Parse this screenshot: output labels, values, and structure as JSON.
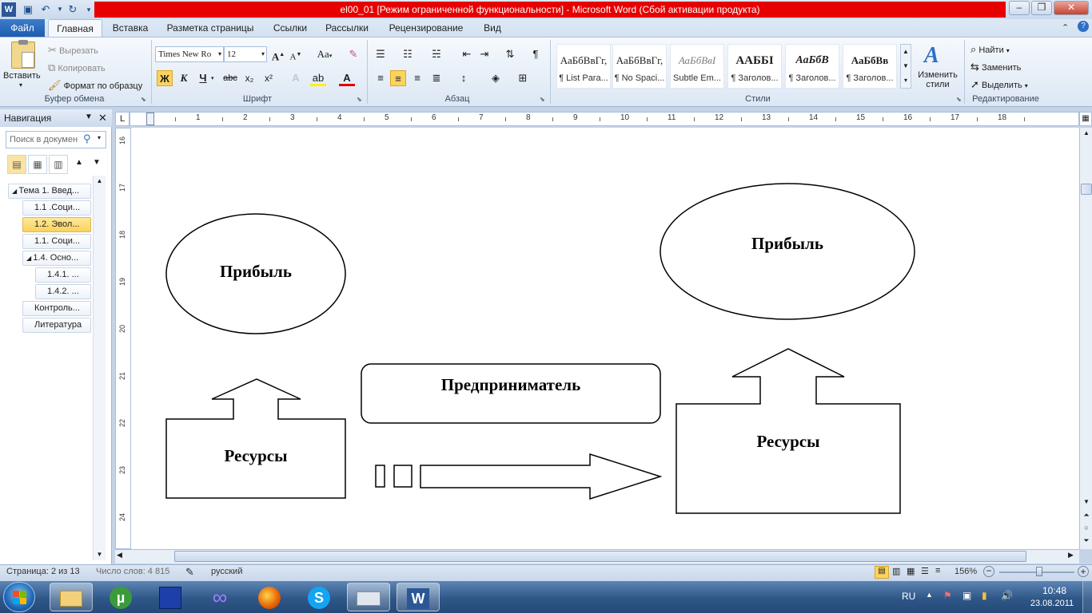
{
  "window": {
    "title": "el00_01 [Режим ограниченной функциональности]  -  Microsoft Word (Сбой активации продукта)",
    "controls": [
      "–",
      "❐",
      "✕"
    ]
  },
  "quick_access": {
    "icons": [
      "word-icon",
      "save-icon",
      "undo-icon",
      "redo-icon",
      "customize-icon"
    ]
  },
  "tabs": {
    "file": "Файл",
    "items": [
      "Главная",
      "Вставка",
      "Разметка страницы",
      "Ссылки",
      "Рассылки",
      "Рецензирование",
      "Вид"
    ],
    "active": "Главная"
  },
  "clipboard": {
    "paste": "Вставить",
    "cut": "Вырезать",
    "copy": "Копировать",
    "format_painter": "Формат по образцу",
    "label": "Буфер обмена"
  },
  "font": {
    "name": "Times New Ro",
    "size": "12",
    "label": "Шрифт",
    "bold": "Ж",
    "italic": "К",
    "underline": "Ч",
    "strike": "abc",
    "sub": "x₂",
    "sup": "x²",
    "grow": "A",
    "shrink": "A",
    "case": "Aa"
  },
  "paragraph": {
    "label": "Абзац"
  },
  "styles": {
    "label": "Стили",
    "items": [
      {
        "sample": "АаБбВвГг,",
        "name": "¶ List Para..."
      },
      {
        "sample": "АаБбВвГг,",
        "name": "¶ No Spaci..."
      },
      {
        "sample": "АаБбВвІ",
        "name": "Subtle Em..."
      },
      {
        "sample": "ААББІ",
        "name": "¶ Заголов..."
      },
      {
        "sample": "АаБбВ",
        "name": "¶ Заголов..."
      },
      {
        "sample": "АаБбВв",
        "name": "¶ Заголов..."
      }
    ],
    "change": "Изменить стили"
  },
  "editing": {
    "label": "Редактирование",
    "find": "Найти",
    "replace": "Заменить",
    "select": "Выделить"
  },
  "nav": {
    "title": "Навигация",
    "search_placeholder": "Поиск в докумен",
    "items": [
      {
        "label": "Тема 1. Введ...",
        "level": 0,
        "expanded": true,
        "selected": false
      },
      {
        "label": "1.1 .Соци...",
        "level": 1,
        "expanded": false,
        "selected": false
      },
      {
        "label": "1.2. Эвол...",
        "level": 1,
        "expanded": false,
        "selected": true
      },
      {
        "label": "1.1. Соци...",
        "level": 1,
        "expanded": false,
        "selected": false
      },
      {
        "label": "1.4. Осно...",
        "level": 1,
        "expanded": true,
        "selected": false
      },
      {
        "label": "1.4.1. ...",
        "level": 2,
        "expanded": false,
        "selected": false
      },
      {
        "label": "1.4.2. ...",
        "level": 2,
        "expanded": false,
        "selected": false
      },
      {
        "label": "Контроль...",
        "level": 1,
        "expanded": false,
        "selected": false
      },
      {
        "label": "Литература",
        "level": 1,
        "expanded": false,
        "selected": false
      }
    ]
  },
  "ruler": {
    "h_numbers": [
      "1",
      "1",
      "2",
      "3",
      "4",
      "5",
      "6",
      "7",
      "8",
      "9",
      "10",
      "11",
      "12",
      "13",
      "14",
      "15",
      "16",
      "17",
      "18"
    ],
    "v_numbers": [
      "16",
      "17",
      "18",
      "19",
      "20",
      "21",
      "22",
      "23",
      "24"
    ]
  },
  "document": {
    "left_profit": "Прибыль",
    "left_resources": "Ресурсы",
    "entrepreneur": "Предприниматель",
    "right_profit": "Прибыль",
    "right_resources": "Ресурсы"
  },
  "status": {
    "page": "Страница: 2 из 13",
    "words": "Число слов: 4 815",
    "language": "русский",
    "zoom": "156%"
  },
  "taskbar": {
    "apps": [
      "start-orb",
      "explorer-icon",
      "utorrent-icon",
      "save-disk-icon",
      "infinity-icon",
      "firefox-icon",
      "skype-icon",
      "keyboard-app-icon",
      "word-icon"
    ],
    "lang": "RU",
    "time": "10:48",
    "date": "23.08.2011"
  }
}
